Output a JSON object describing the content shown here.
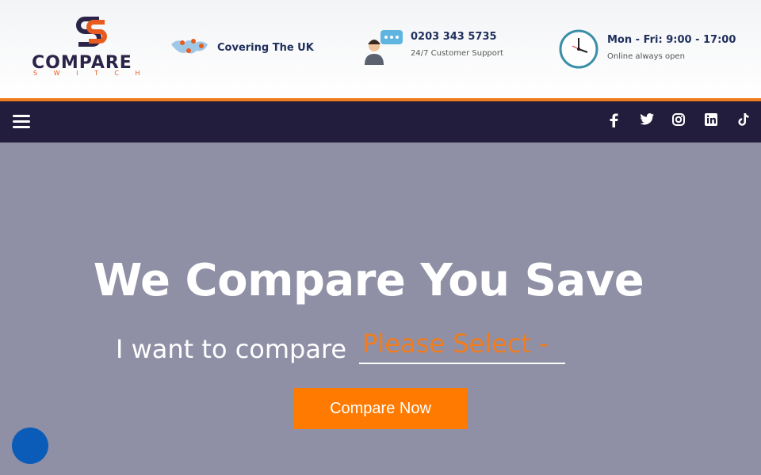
{
  "brand": {
    "name": "COMPARE",
    "tagline": "S W I T C H",
    "colors": {
      "navy": "#2b2448",
      "orange": "#e85b20"
    }
  },
  "header": {
    "coverage": {
      "icon": "world-map-icon",
      "text": "Covering The UK"
    },
    "phone": {
      "icon": "support-agent-icon",
      "number": "0203 343 5735",
      "caption": "24/7 Customer Support"
    },
    "hours": {
      "icon": "clock-icon",
      "text": "Mon - Fri: 9:00 - 17:00",
      "caption": "Online always open"
    }
  },
  "nav": {
    "menu_icon": "hamburger-menu-icon",
    "socials": [
      {
        "name": "facebook-icon",
        "glyph": "f"
      },
      {
        "name": "twitter-icon",
        "glyph": "t"
      },
      {
        "name": "instagram-icon",
        "glyph": "ig"
      },
      {
        "name": "linkedin-icon",
        "glyph": "in"
      },
      {
        "name": "tiktok-icon",
        "glyph": "tt"
      }
    ]
  },
  "hero": {
    "title": "We Compare You Save",
    "compare_label": "I want to compare",
    "select_value": "Please Select -",
    "cta_label": "Compare Now"
  },
  "colors": {
    "accent": "#ff7a00",
    "nav_bg": "#231d3d",
    "hero_bg": "#8f8fa6",
    "chat": "#0b5cb8"
  }
}
